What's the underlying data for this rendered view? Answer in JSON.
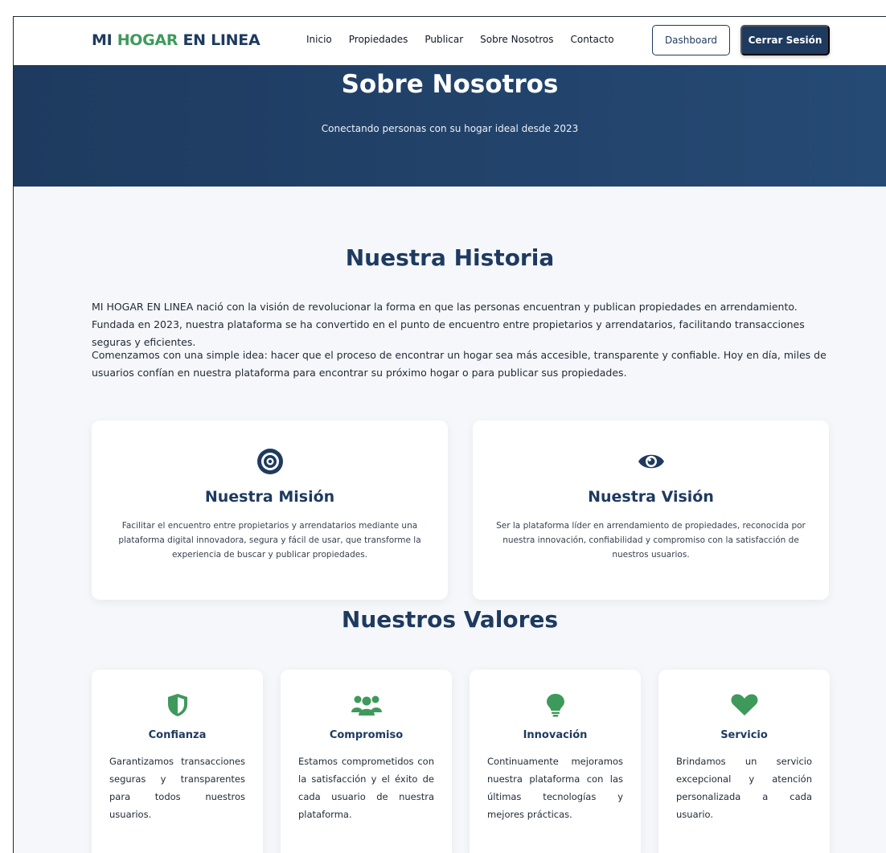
{
  "nav": {
    "brand_part1": "MI ",
    "brand_accent": "HOGAR",
    "brand_part2": " EN LINEA",
    "links": [
      "Inicio",
      "Propiedades",
      "Publicar",
      "Sobre Nosotros",
      "Contacto"
    ],
    "dashboard_label": "Dashboard",
    "logout_label": "Cerrar Sesión"
  },
  "hero": {
    "title": "Sobre Nosotros",
    "subtitle": "Conectando personas con su hogar ideal desde 2023"
  },
  "history": {
    "title": "Nuestra Historia",
    "paragraph1": "MI HOGAR EN LINEA nació con la visión de revolucionar la forma en que las personas encuentran y publican propiedades en arrendamiento. Fundada en 2023, nuestra plataforma se ha convertido en el punto de encuentro entre propietarios y arrendatarios, facilitando transacciones seguras y eficientes.",
    "paragraph2": "Comenzamos con una simple idea: hacer que el proceso de encontrar un hogar sea más accesible, transparente y confiable. Hoy en día, miles de usuarios confían en nuestra plataforma para encontrar su próximo hogar o para publicar sus propiedades."
  },
  "mission": {
    "icon": "target-icon",
    "title": "Nuestra Misión",
    "text": "Facilitar el encuentro entre propietarios y arrendatarios mediante una plataforma digital innovadora, segura y fácil de usar, que transforme la experiencia de buscar y publicar propiedades."
  },
  "vision": {
    "icon": "eye-icon",
    "title": "Nuestra Visión",
    "text": "Ser la plataforma líder en arrendamiento de propiedades, reconocida por nuestra innovación, confiabilidad y compromiso con la satisfacción de nuestros usuarios."
  },
  "values": {
    "title": "Nuestros Valores",
    "items": [
      {
        "icon": "shield-icon",
        "title": "Confianza",
        "text": "Garantizamos transacciones seguras y transparentes para todos nuestros usuarios."
      },
      {
        "icon": "users-icon",
        "title": "Compromiso",
        "text": "Estamos comprometidos con la satisfacción y el éxito de cada usuario de nuestra plataforma."
      },
      {
        "icon": "lightbulb-icon",
        "title": "Innovación",
        "text": "Continuamente mejoramos nuestra plataforma con las últimas tecnologías y mejores prácticas."
      },
      {
        "icon": "heart-icon",
        "title": "Servicio",
        "text": "Brindamos un servicio excepcional y atención personalizada a cada usuario."
      }
    ]
  },
  "colors": {
    "primary": "#1e3a5f",
    "accent": "#3e9a5b",
    "background": "#f5f7fa"
  }
}
